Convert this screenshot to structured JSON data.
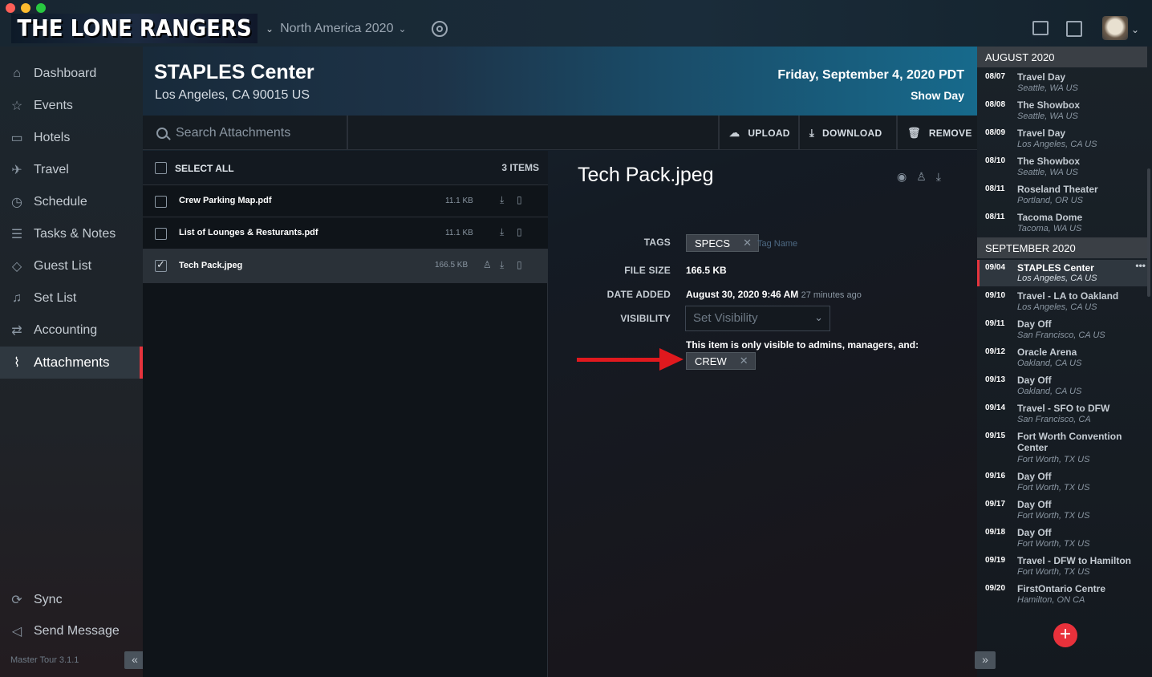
{
  "app": {
    "logo_text": "THE LONE RANGERS",
    "tour": "North America 2020",
    "version": "Master Tour 3.1.1"
  },
  "colors": {
    "accent": "#e5343d",
    "arrow": "#e0191e",
    "add_button": "#e8313b"
  },
  "sidebar": {
    "items": [
      {
        "label": "Dashboard",
        "icon": "home-icon"
      },
      {
        "label": "Events",
        "icon": "star-icon"
      },
      {
        "label": "Hotels",
        "icon": "hotel-icon"
      },
      {
        "label": "Travel",
        "icon": "plane-icon"
      },
      {
        "label": "Schedule",
        "icon": "clock-icon"
      },
      {
        "label": "Tasks & Notes",
        "icon": "list-icon"
      },
      {
        "label": "Guest List",
        "icon": "tag-icon"
      },
      {
        "label": "Set List",
        "icon": "music-icon"
      },
      {
        "label": "Accounting",
        "icon": "money-icon"
      },
      {
        "label": "Attachments",
        "icon": "paperclip-icon",
        "active": true
      }
    ],
    "sync": "Sync",
    "send_message": "Send Message"
  },
  "venue": {
    "name": "STAPLES Center",
    "address": "Los Angeles, CA 90015 US",
    "date": "Friday, September 4, 2020 PDT",
    "day_type": "Show Day"
  },
  "toolbar": {
    "search_placeholder": "Search Attachments",
    "upload": "UPLOAD",
    "download": "DOWNLOAD",
    "remove": "REMOVE"
  },
  "list": {
    "select_all": "SELECT ALL",
    "count": "3 ITEMS",
    "files": [
      {
        "name": "Crew Parking Map.pdf",
        "size": "11.1 KB",
        "checked": false
      },
      {
        "name": "List of Lounges & Resturants.pdf",
        "size": "11.1 KB",
        "checked": false
      },
      {
        "name": "Tech Pack.jpeg",
        "size": "166.5 KB",
        "checked": true
      }
    ]
  },
  "detail": {
    "title": "Tech Pack.jpeg",
    "labels": {
      "tags": "TAGS",
      "file_size": "FILE SIZE",
      "date_added": "DATE ADDED",
      "visibility": "VISIBILITY"
    },
    "tag": "SPECS",
    "tag_placeholder": "Tag Name",
    "file_size": "166.5 KB",
    "date_added": "August 30, 2020 9:46 AM",
    "date_relative": "27 minutes ago",
    "visibility_placeholder": "Set Visibility",
    "visibility_note": "This item is only visible to admins, managers, and:",
    "visibility_group": "CREW"
  },
  "schedule": {
    "months": [
      {
        "label": "AUGUST 2020",
        "events": [
          {
            "date": "08/07",
            "name": "Travel Day",
            "location": "Seattle, WA US"
          },
          {
            "date": "08/08",
            "name": "The Showbox",
            "location": "Seattle, WA US"
          },
          {
            "date": "08/09",
            "name": "Travel Day",
            "location": "Los Angeles, CA US"
          },
          {
            "date": "08/10",
            "name": "The Showbox",
            "location": "Seattle, WA US"
          },
          {
            "date": "08/11",
            "name": "Roseland Theater",
            "location": "Portland, OR US"
          },
          {
            "date": "08/11",
            "name": "Tacoma Dome",
            "location": "Tacoma, WA US"
          }
        ]
      },
      {
        "label": "SEPTEMBER 2020",
        "events": [
          {
            "date": "09/04",
            "name": "STAPLES Center",
            "location": "Los Angeles, CA US",
            "current": true
          },
          {
            "date": "09/10",
            "name": "Travel - LA to Oakland",
            "location": "Los Angeles, CA US"
          },
          {
            "date": "09/11",
            "name": "Day Off",
            "location": "San Francisco, CA US"
          },
          {
            "date": "09/12",
            "name": "Oracle Arena",
            "location": "Oakland, CA US"
          },
          {
            "date": "09/13",
            "name": "Day Off",
            "location": "Oakland, CA US"
          },
          {
            "date": "09/14",
            "name": "Travel - SFO to DFW",
            "location": "San Francisco, CA"
          },
          {
            "date": "09/15",
            "name": "Fort Worth Convention Center",
            "location": "Fort Worth, TX US"
          },
          {
            "date": "09/16",
            "name": "Day Off",
            "location": "Fort Worth, TX US"
          },
          {
            "date": "09/17",
            "name": "Day Off",
            "location": "Fort Worth, TX US"
          },
          {
            "date": "09/18",
            "name": "Day Off",
            "location": "Fort Worth, TX US"
          },
          {
            "date": "09/19",
            "name": "Travel - DFW to Hamilton",
            "location": "Fort Worth, TX US"
          },
          {
            "date": "09/20",
            "name": "FirstOntario Centre",
            "location": "Hamilton, ON CA"
          }
        ]
      }
    ]
  }
}
